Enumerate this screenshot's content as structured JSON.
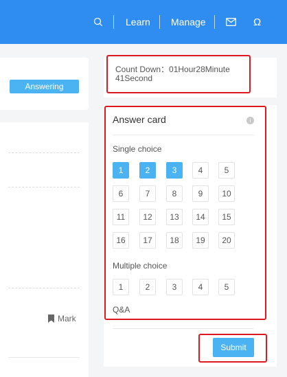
{
  "header": {
    "search_icon_glyph": "Q",
    "learn_label": "Learn",
    "manage_label": "Manage",
    "omega_glyph": "Ω",
    "bg_color": "#2f8cf0"
  },
  "left_panel": {
    "status_badge": "Answering",
    "mark_label": "Mark"
  },
  "countdown": {
    "text": "Count Down：01Hour28Minute 41Second"
  },
  "answer_card": {
    "title": "Answer card",
    "info_glyph": "i",
    "single_choice_label": "Single choice",
    "single_choice_items": [
      {
        "label": "1",
        "answered": true
      },
      {
        "label": "2",
        "answered": true
      },
      {
        "label": "3",
        "answered": true
      },
      {
        "label": "4",
        "answered": false
      },
      {
        "label": "5",
        "answered": false
      },
      {
        "label": "6",
        "answered": false
      },
      {
        "label": "7",
        "answered": false
      },
      {
        "label": "8",
        "answered": false
      },
      {
        "label": "9",
        "answered": false
      },
      {
        "label": "10",
        "answered": false
      },
      {
        "label": "11",
        "answered": false
      },
      {
        "label": "12",
        "answered": false
      },
      {
        "label": "13",
        "answered": false
      },
      {
        "label": "14",
        "answered": false
      },
      {
        "label": "15",
        "answered": false
      },
      {
        "label": "16",
        "answered": false
      },
      {
        "label": "17",
        "answered": false
      },
      {
        "label": "18",
        "answered": false
      },
      {
        "label": "19",
        "answered": false
      },
      {
        "label": "20",
        "answered": false
      }
    ],
    "multiple_choice_label": "Multiple choice",
    "multiple_choice_items": [
      {
        "label": "1",
        "answered": false
      },
      {
        "label": "2",
        "answered": false
      },
      {
        "label": "3",
        "answered": false
      },
      {
        "label": "4",
        "answered": false
      },
      {
        "label": "5",
        "answered": false
      }
    ],
    "qa_label": "Q&A",
    "submit_label": "Submit",
    "answered_color": "#4cb3f2",
    "highlight_color": "#e0191e"
  }
}
